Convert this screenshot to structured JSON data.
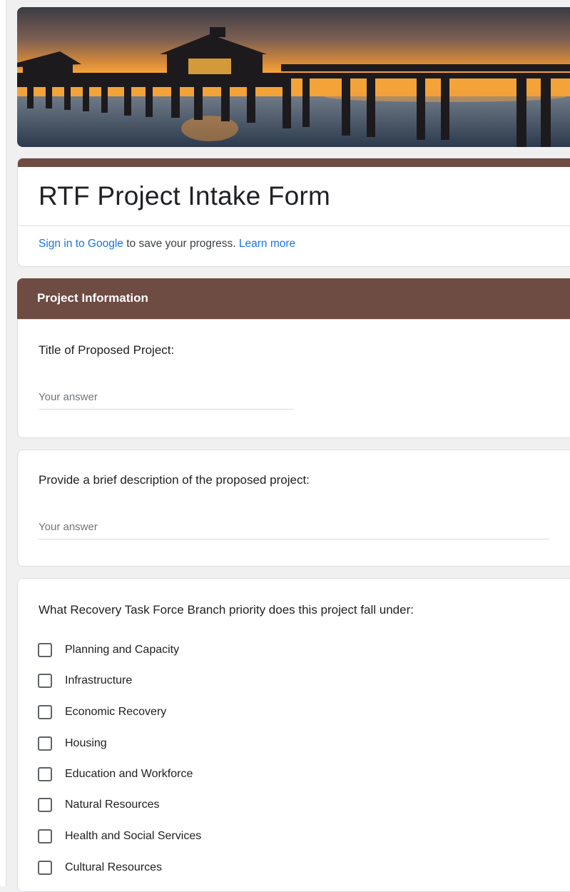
{
  "form": {
    "title": "RTF Project Intake Form",
    "signin_link": "Sign in to Google",
    "signin_text": " to save your progress. ",
    "learn_more": "Learn more"
  },
  "section": {
    "title": "Project Information"
  },
  "questions": [
    {
      "title": "Title of Proposed Project:",
      "placeholder": "Your answer"
    },
    {
      "title": "Provide a brief description of the proposed project:",
      "placeholder": "Your answer"
    },
    {
      "title": "What Recovery Task Force Branch priority does this project fall under:",
      "options": [
        "Planning and Capacity",
        "Infrastructure",
        "Economic Recovery",
        "Housing",
        "Education and Workforce",
        "Natural Resources",
        "Health and Social Services",
        "Cultural Resources"
      ]
    }
  ],
  "colors": {
    "accent": "#6e4b43",
    "link": "#1a73e8"
  }
}
